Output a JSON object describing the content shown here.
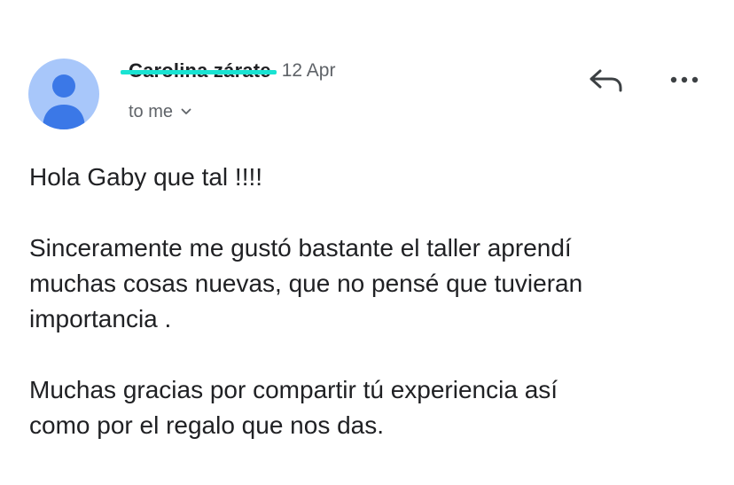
{
  "message": {
    "sender_name": "Carolina zárate",
    "date": "12 Apr",
    "recipient": "to me",
    "paragraphs": [
      "Hola Gaby que tal !!!!",
      "Sinceramente me gustó bastante el taller aprendí\nmuchas cosas nuevas, que no pensé que tuvieran\nimportancia .",
      "Muchas gracias por compartir tú experiencia así\ncomo por el regalo que nos das."
    ]
  },
  "icons": {
    "avatar": "person-icon",
    "reply": "reply-icon",
    "more": "more-horizontal-icon",
    "recipient_toggle": "chevron-down-icon"
  },
  "colors": {
    "avatar_bg": "#a8c7fa",
    "avatar_fg": "#4f86ec",
    "redaction": "#19e3d2",
    "secondary_text": "#5f6368",
    "primary_text": "#202124"
  }
}
